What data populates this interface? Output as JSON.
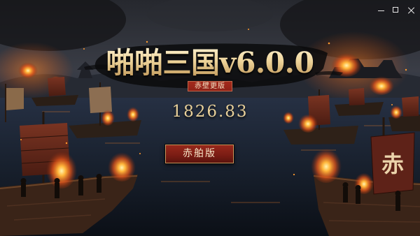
{
  "window": {
    "minimize_icon": "minimize-icon",
    "maximize_icon": "maximize-icon",
    "close_icon": "close-icon"
  },
  "title": {
    "main": "啪啪三国v6.0.0",
    "subtitle": "赤壁更版"
  },
  "score": "1826.83",
  "launch_button": {
    "label": "赤舶版"
  },
  "scene": {
    "flag_text": "赤"
  },
  "colors": {
    "title_gold": "#eed49a",
    "subtitle_red": "#8f2217",
    "button_red": "#7c1d14",
    "button_border": "#c8965c",
    "fire_orange": "#ff9a2e"
  }
}
